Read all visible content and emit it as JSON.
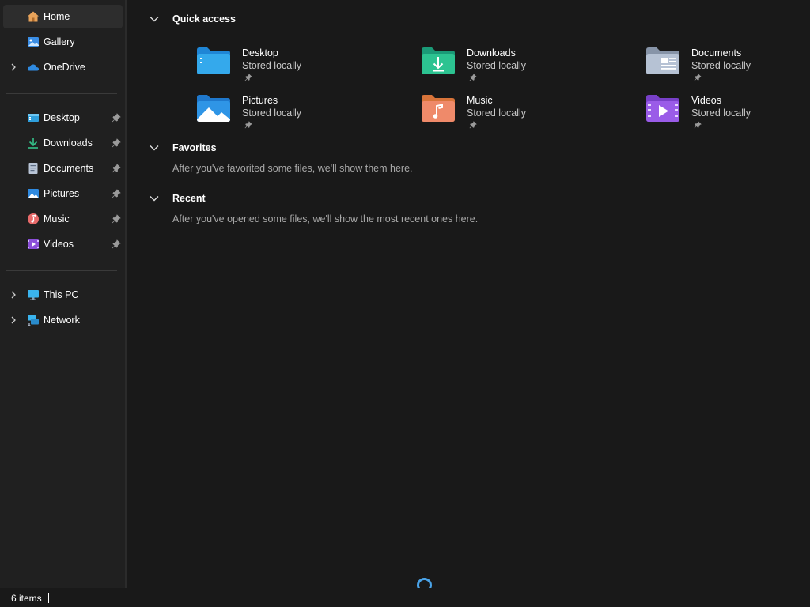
{
  "sidebar": {
    "top_items": [
      {
        "label": "Home",
        "icon": "home-icon",
        "selected": true
      },
      {
        "label": "Gallery",
        "icon": "gallery-icon"
      },
      {
        "label": "OneDrive",
        "icon": "onedrive-icon",
        "expandable": true
      }
    ],
    "pinned_items": [
      {
        "label": "Desktop",
        "icon": "desktop-folder-icon"
      },
      {
        "label": "Downloads",
        "icon": "downloads-icon"
      },
      {
        "label": "Documents",
        "icon": "documents-icon"
      },
      {
        "label": "Pictures",
        "icon": "pictures-icon"
      },
      {
        "label": "Music",
        "icon": "music-icon"
      },
      {
        "label": "Videos",
        "icon": "videos-icon"
      }
    ],
    "bottom_items": [
      {
        "label": "This PC",
        "icon": "this-pc-icon",
        "expandable": true
      },
      {
        "label": "Network",
        "icon": "network-icon",
        "expandable": true
      }
    ]
  },
  "main": {
    "quick_access": {
      "title": "Quick access",
      "items": [
        {
          "name": "Desktop",
          "status": "Stored locally",
          "icon": "desktop-folder-icon"
        },
        {
          "name": "Downloads",
          "status": "Stored locally",
          "icon": "downloads-folder-icon"
        },
        {
          "name": "Documents",
          "status": "Stored locally",
          "icon": "documents-folder-icon"
        },
        {
          "name": "Pictures",
          "status": "Stored locally",
          "icon": "pictures-folder-icon"
        },
        {
          "name": "Music",
          "status": "Stored locally",
          "icon": "music-folder-icon"
        },
        {
          "name": "Videos",
          "status": "Stored locally",
          "icon": "videos-folder-icon"
        }
      ]
    },
    "favorites": {
      "title": "Favorites",
      "message": "After you've favorited some files, we'll show them here."
    },
    "recent": {
      "title": "Recent",
      "message": "After you've opened some files, we'll show the most recent ones here."
    }
  },
  "statusbar": {
    "item_count": "6 items"
  },
  "colors": {
    "background": "#191919",
    "sidebar": "#202020",
    "selected": "#2d2d2d",
    "accent": "#4aa3e8",
    "muted_text": "#a8a8a8"
  }
}
